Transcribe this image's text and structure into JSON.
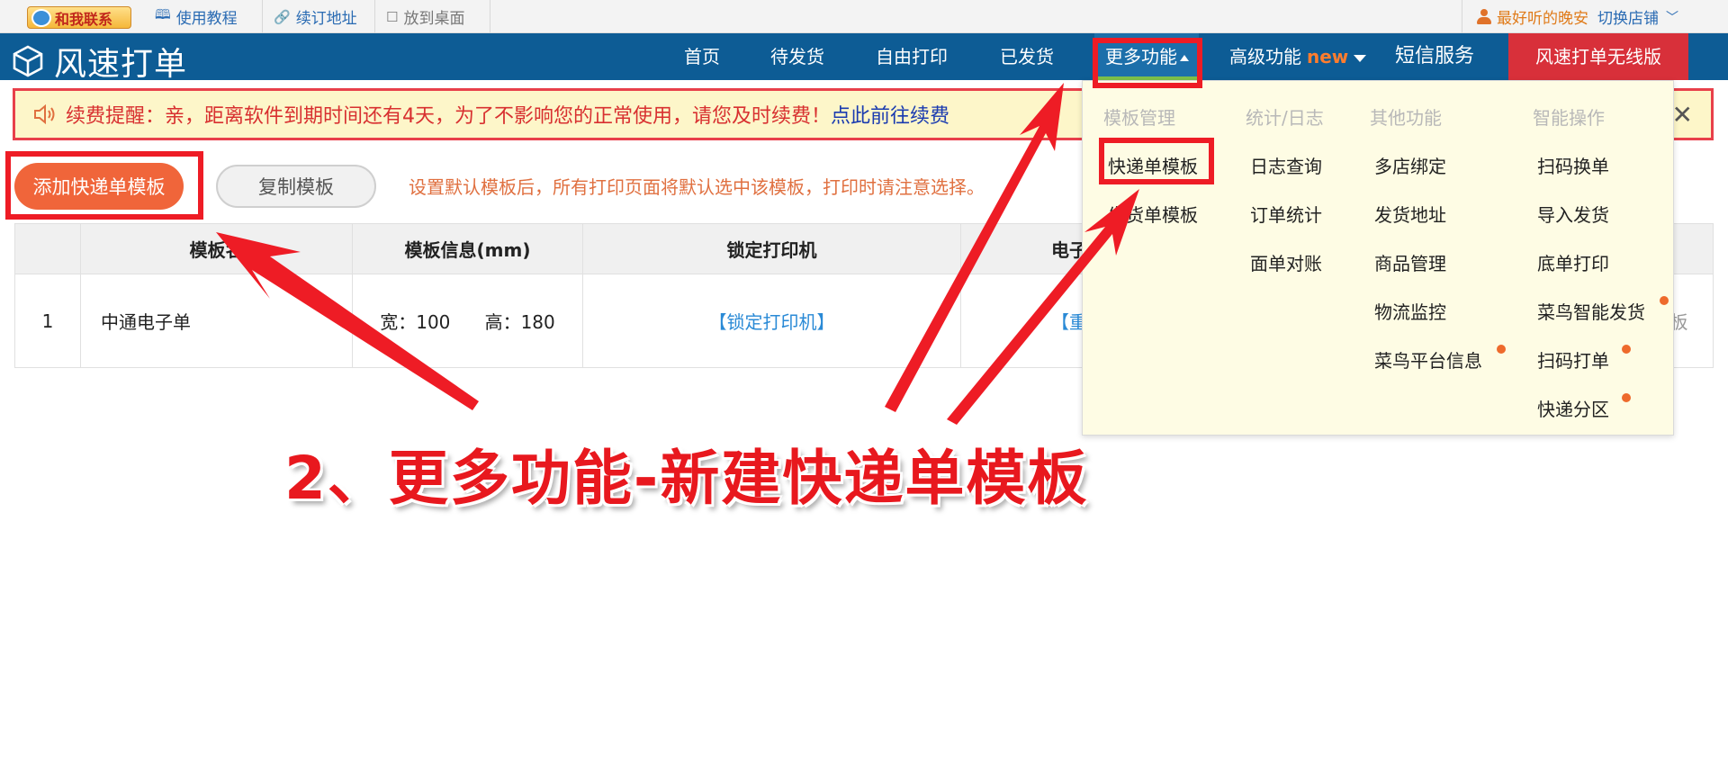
{
  "utilbar": {
    "contact_label": "和我联系",
    "tutorial_label": "使用教程",
    "bookmark_label": "续订地址",
    "desktop_label": "放到桌面",
    "user_name": "最好听的晚安",
    "switch_shop_label": "切换店铺"
  },
  "brand": {
    "name": "风速打单"
  },
  "nav": {
    "home": "首页",
    "pending": "待发货",
    "free_print": "自由打印",
    "shipped": "已发货",
    "more": "更多功能",
    "advanced": "高级功能",
    "advanced_badge": "new",
    "sms": "短信服务",
    "wireless": "风速打单无线版"
  },
  "renewal": {
    "text": "续费提醒：亲，距离软件到期时间还有4天，为了不影响您的正常使用，请您及时续费！",
    "link": "点此前往续费"
  },
  "toolbar": {
    "add_template": "添加快递单模板",
    "copy_template": "复制模板",
    "hint": "设置默认模板后，所有打印页面将默认选中该模板，打印时请注意选择。"
  },
  "table": {
    "headers": [
      "",
      "模板名",
      "模板信息(mm)",
      "锁定打印机",
      "电子"
    ],
    "rows": [
      {
        "index": "1",
        "name": "中通电子单",
        "width": "宽：100",
        "height": "高：180",
        "lock": "【锁定打印机】",
        "action": "【重",
        "tail": "板"
      }
    ]
  },
  "dropdown": {
    "columns": [
      {
        "header": "模板管理",
        "items": [
          "快递单模板",
          "发货单模板"
        ]
      },
      {
        "header": "统计/日志",
        "items": [
          "日志查询",
          "订单统计",
          "面单对账"
        ]
      },
      {
        "header": "其他功能",
        "items": [
          "多店绑定",
          "发货地址",
          "商品管理",
          "物流监控",
          "菜鸟平台信息"
        ]
      },
      {
        "header": "智能操作",
        "items": [
          "扫码换单",
          "导入发货",
          "底单打印",
          "菜鸟智能发货",
          "扫码打单",
          "快递分区"
        ]
      }
    ]
  },
  "annotation": {
    "caption": "2、更多功能-新建快递单模板"
  },
  "colors": {
    "nav_bg": "#0d5c95",
    "accent_red": "#ee1c25",
    "add_button": "#f0653a",
    "dropdown_bg": "#fefce4"
  }
}
